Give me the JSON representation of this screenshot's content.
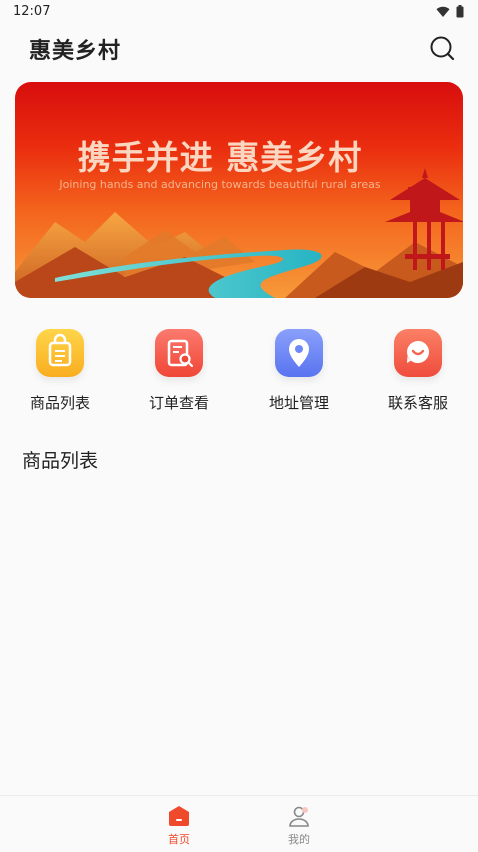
{
  "status_bar": {
    "time": "12:07",
    "icons": [
      "wifi-icon",
      "battery-icon"
    ]
  },
  "header": {
    "title": "惠美乡村",
    "search_icon": "search-icon"
  },
  "banner": {
    "headline": "携手并进 惠美乡村",
    "subtitle": "Joining hands and advancing towards beautiful rural areas"
  },
  "quick_menu": [
    {
      "label": "商品列表",
      "icon": "shopping-bag-icon",
      "color": "#fbbd2a"
    },
    {
      "label": "订单查看",
      "icon": "order-search-icon",
      "color": "#f7574e"
    },
    {
      "label": "地址管理",
      "icon": "location-pin-icon",
      "color": "#6f88f7"
    },
    {
      "label": "联系客服",
      "icon": "customer-service-icon",
      "color": "#f76250"
    }
  ],
  "product_section": {
    "title": "商品列表"
  },
  "tab_bar": {
    "tabs": [
      {
        "label": "首页",
        "icon": "home-icon",
        "active": true
      },
      {
        "label": "我的",
        "icon": "user-icon",
        "active": false
      }
    ]
  },
  "colors": {
    "accent": "#f04a2c",
    "inactive": "#888888"
  }
}
